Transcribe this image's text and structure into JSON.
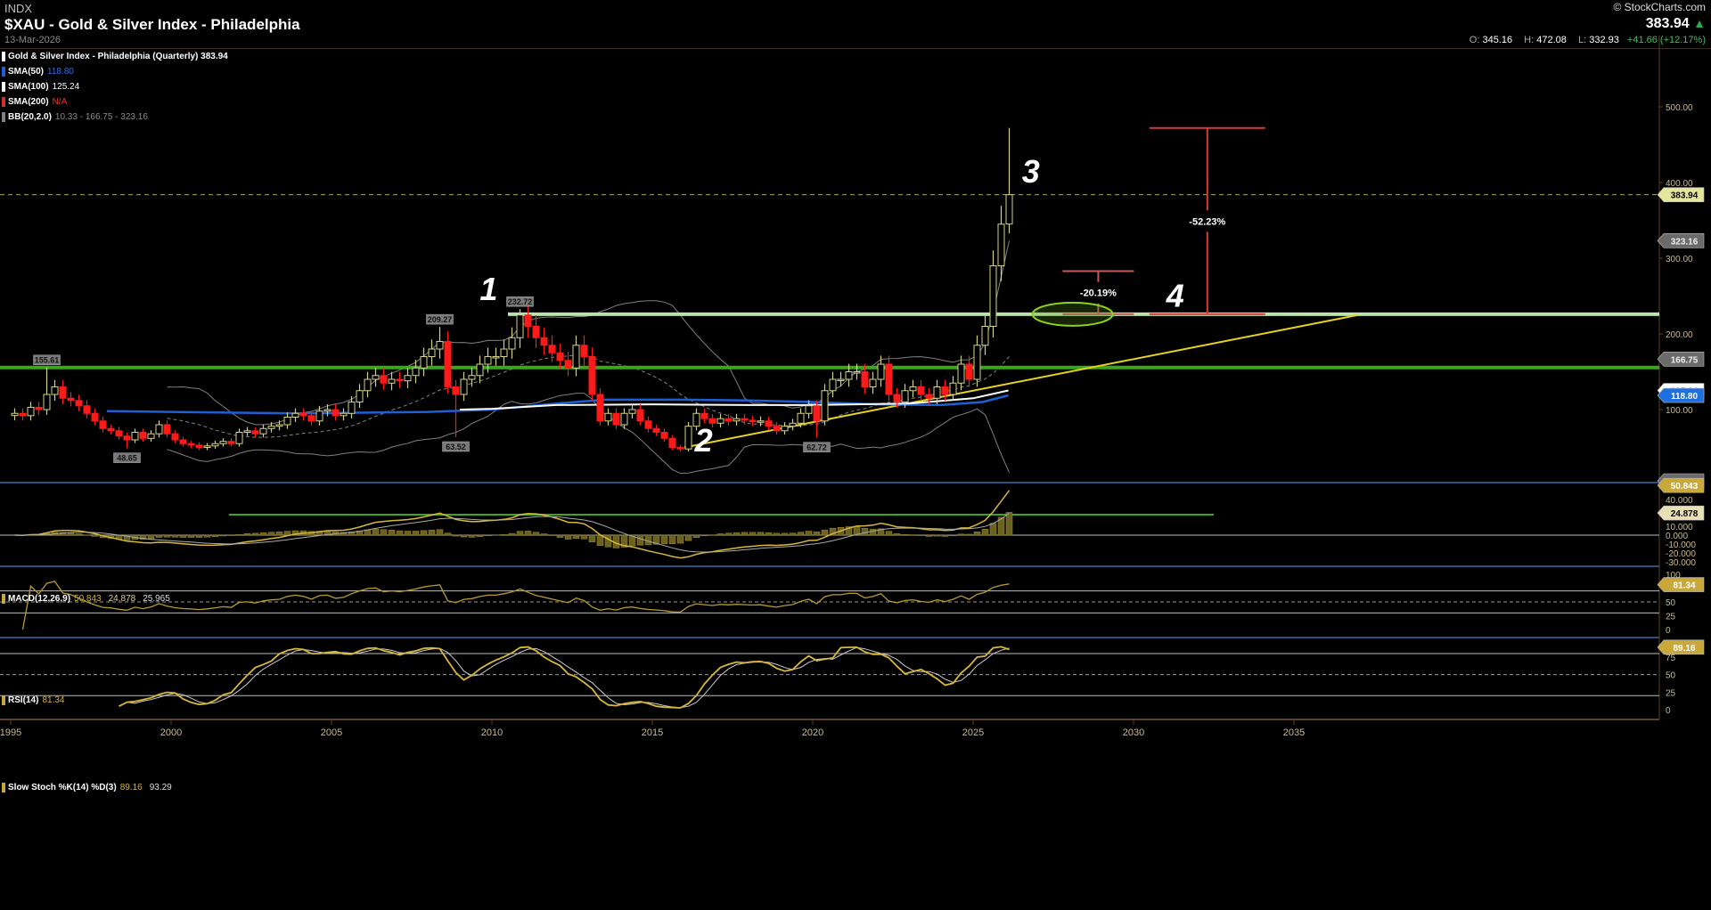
{
  "header": {
    "exchange": "INDX",
    "title": "$XAU - Gold & Silver Index - Philadelphia",
    "date": "13-Mar-2026",
    "brand": "© StockCharts.com",
    "last": "383.94",
    "open_label": "O:",
    "open": "345.16",
    "high_label": "H:",
    "high": "472.08",
    "low_label": "L:",
    "low": "332.93",
    "change": "+41.66 (+12.17%)"
  },
  "legend": {
    "price": {
      "label": "Gold & Silver Index - Philadelphia (Quarterly) 383.94"
    },
    "sma50": {
      "label": "SMA(50)",
      "value": "118.80"
    },
    "sma100": {
      "label": "SMA(100)",
      "value": "125.24"
    },
    "sma200": {
      "label": "SMA(200)",
      "value": "N/A"
    },
    "bb": {
      "label": "BB(20,2.0)",
      "value": "10.33 - 166.75 - 323.16"
    },
    "macd": {
      "label": "MACD(12,26,9)",
      "v1": "50.843",
      "v2": "24.878",
      "v3": "25.965"
    },
    "rsi": {
      "label": "RSI(14)",
      "value": "81.34"
    },
    "stoch": {
      "label": "Slow Stoch %K(14) %D(3)",
      "v1": "89.16",
      "v2": "93.29"
    }
  },
  "colors": {
    "up": "#d2d28c",
    "down": "#ff1a1a",
    "sma50": "#1f5fd6",
    "sma100": "#ffffff",
    "sma200": "#d32f2f",
    "bb": "#808080",
    "resistance": "#3aa81a",
    "breakout": "#b9e6a8",
    "trend": "#e8d21a",
    "measure": "#d84a4a",
    "ind": "#c9a83a"
  },
  "chart_data": [
    {
      "type": "candlestick",
      "title": "$XAU - Gold & Silver Index - Philadelphia (Quarterly)",
      "period": "quarterly",
      "start": "1995Q1",
      "scale": "linear",
      "ylim": [
        0,
        560
      ],
      "xlim": [
        1995,
        2037
      ],
      "x_ticks": [
        "1995",
        "2000",
        "2005",
        "2010",
        "2015",
        "2020",
        "2025",
        "2030",
        "2035"
      ],
      "y_ticks": [
        "100.00",
        "200.00",
        "300.00",
        "400.00",
        "500.00"
      ],
      "closes": [
        95,
        92,
        103,
        100,
        120,
        130,
        115,
        112,
        105,
        95,
        85,
        75,
        72,
        65,
        60,
        70,
        62,
        68,
        80,
        68,
        60,
        55,
        53,
        50,
        52,
        55,
        58,
        55,
        70,
        72,
        68,
        75,
        78,
        80,
        90,
        95,
        92,
        85,
        98,
        100,
        92,
        95,
        110,
        125,
        140,
        145,
        135,
        140,
        138,
        145,
        155,
        170,
        180,
        190,
        130,
        120,
        140,
        145,
        160,
        170,
        170,
        180,
        195,
        225,
        210,
        195,
        185,
        175,
        165,
        155,
        185,
        170,
        120,
        85,
        95,
        80,
        95,
        100,
        85,
        75,
        70,
        62,
        50,
        48,
        78,
        95,
        88,
        82,
        88,
        85,
        88,
        86,
        84,
        85,
        78,
        72,
        78,
        82,
        95,
        105,
        85,
        125,
        140,
        140,
        150,
        150,
        130,
        140,
        160,
        120,
        110,
        125,
        130,
        120,
        115,
        130,
        120,
        135,
        160,
        140,
        185,
        210,
        290,
        345,
        383.94
      ],
      "last_candle": {
        "open": 345.16,
        "high": 472.08,
        "low": 332.93,
        "close": 383.94
      },
      "annotated_extremes": [
        {
          "index": 4,
          "type": "high",
          "value": 155.61,
          "label": "155.61"
        },
        {
          "index": 14,
          "type": "low",
          "value": 48.65,
          "label": "48.65"
        },
        {
          "index": 53,
          "type": "high",
          "value": 209.27,
          "label": "209.27"
        },
        {
          "index": 55,
          "type": "low",
          "value": 63.52,
          "label": "63.52"
        },
        {
          "index": 63,
          "type": "high",
          "value": 232.72,
          "label": "232.72"
        },
        {
          "index": 100,
          "type": "low",
          "value": 62.72,
          "label": "62.72"
        }
      ],
      "sma50": [
        [
          1998.0,
          98
        ],
        [
          2000,
          97
        ],
        [
          2004,
          95
        ],
        [
          2008,
          97
        ],
        [
          2010,
          100
        ],
        [
          2012,
          108
        ],
        [
          2013.5,
          113
        ],
        [
          2016,
          113
        ],
        [
          2018,
          112
        ],
        [
          2020,
          110
        ],
        [
          2022,
          107
        ],
        [
          2024,
          106
        ],
        [
          2025.3,
          110
        ],
        [
          2026.1,
          118.8
        ]
      ],
      "sma100": [
        [
          2009.0,
          100
        ],
        [
          2010,
          101
        ],
        [
          2012,
          106
        ],
        [
          2015,
          107
        ],
        [
          2018,
          106
        ],
        [
          2020,
          106
        ],
        [
          2023,
          108
        ],
        [
          2025,
          115
        ],
        [
          2026.1,
          125.24
        ]
      ],
      "bb_last": {
        "lower": 10.33,
        "middle": 166.75,
        "upper": 323.16
      },
      "levels": [
        {
          "name": "resistance",
          "value": 155.61
        },
        {
          "name": "breakout",
          "value": 226
        }
      ],
      "trendline": [
        [
          2016.0,
          50
        ],
        [
          2037,
          225
        ]
      ],
      "annotations": [
        {
          "label": "1",
          "x": 2009.9,
          "y": 245
        },
        {
          "label": "2",
          "x": 2016.6,
          "y": 45
        },
        {
          "label": "3",
          "x": 2026.8,
          "y": 400
        },
        {
          "label": "4",
          "x": 2031.3,
          "y": 236
        }
      ],
      "measures": [
        {
          "label": "-20.19%",
          "x": 2028.9,
          "from": 283,
          "to": 226
        },
        {
          "label": "-52.23%",
          "x": 2032.3,
          "from": 472.08,
          "to": 226
        }
      ],
      "ellipse": {
        "x": 2028.1,
        "y": 226
      },
      "axis_tags": [
        {
          "value": 383.94,
          "label": "383.94",
          "kind": "price"
        },
        {
          "value": 323.16,
          "label": "323.16",
          "kind": "bb"
        },
        {
          "value": 166.75,
          "label": "166.75",
          "kind": "bb"
        },
        {
          "value": 125.24,
          "label": "125.24",
          "kind": "sma100"
        },
        {
          "value": 118.8,
          "label": "118.80",
          "kind": "sma50"
        },
        {
          "value": 10.33,
          "label": "10.33",
          "kind": "bb"
        }
      ]
    },
    {
      "type": "line",
      "title": "MACD(12,26,9)",
      "y_ticks": [
        "40.000",
        "10.000",
        "0.000",
        "-10.000",
        "-20.000",
        "-30.000"
      ],
      "ylim": [
        -35,
        45
      ],
      "level": 23,
      "tags": [
        {
          "value": 50.843,
          "label": "50.843"
        },
        {
          "value": 24.878,
          "label": "24.878"
        }
      ]
    },
    {
      "type": "line",
      "title": "RSI(14)",
      "y_ticks": [
        "100",
        "50",
        "25",
        "0"
      ],
      "ylim": [
        0,
        100
      ],
      "tags": [
        {
          "value": 81.34,
          "label": "81.34"
        }
      ]
    },
    {
      "type": "line",
      "title": "Slow Stoch %K(14) %D(3)",
      "y_ticks": [
        "75",
        "50",
        "25",
        "0"
      ],
      "ylim": [
        0,
        100
      ],
      "tags": [
        {
          "value": 89.16,
          "label": "89.16"
        }
      ]
    }
  ]
}
